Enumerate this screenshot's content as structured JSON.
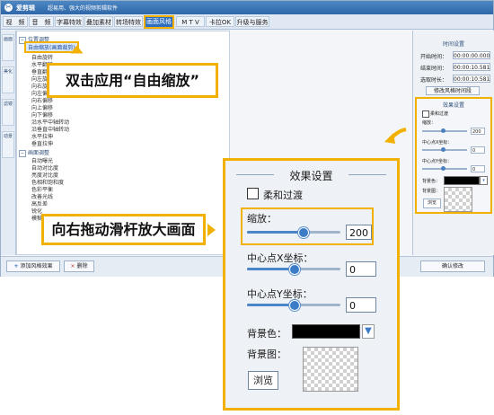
{
  "app": {
    "name": "爱剪辑",
    "slogan": "超易用、强大的视频剪辑软件",
    "menu": [
      "视　频",
      "音　频",
      "字幕特效",
      "叠加素材",
      "转场特效",
      "画面风格",
      "M T V",
      "卡拉OK",
      "升级与服务"
    ],
    "active_menu": "画面风格"
  },
  "left_strip": {
    "tabs": [
      "画面",
      "美化",
      "滤镜",
      "动景"
    ]
  },
  "effect_list": {
    "groups": [
      {
        "label": "位置调整",
        "items": [
          "自由缩放(画面裁剪)",
          "自由旋转",
          "水平翻转",
          "垂直翻转",
          "向左旋转",
          "向右旋转",
          "向左偏移",
          "向右偏移",
          "向上偏移",
          "向下偏移",
          "沿水平中轴转动",
          "沿垂直中轴转动",
          "水平拉伸",
          "垂直拉伸"
        ]
      },
      {
        "label": "画面调整",
        "items": [
          "自动曝光",
          "自动对比度",
          "亮度对比度",
          "色相和饱和度",
          "色彩平衡",
          "改善光线",
          "高反差",
          "锐化",
          "模糊"
        ]
      }
    ],
    "selected_item": "自由缩放(画面裁剪)"
  },
  "right_panel": {
    "time_title": "时间设置",
    "start_label": "开始时间：",
    "start_value": "00:00:00.000",
    "end_label": "结束时间：",
    "end_value": "00:00:10.581",
    "duration_label": "选取时长：",
    "duration_value": "00:00:10.581",
    "time_button": "修改风格时间段",
    "effects_title": "效果设置",
    "smooth_label": "柔和过渡",
    "zoom_label": "缩放：",
    "zoom_value": "200",
    "cx_label": "中心点X坐标：",
    "cx_value": "0",
    "cy_label": "中心点Y坐标：",
    "cy_value": "0",
    "bg_color_label": "背景色：",
    "bg_image_label": "背景图：",
    "browse_label": "浏览"
  },
  "bottom_bar": {
    "add_button": "添加风格效果",
    "delete_button": "删除",
    "confirm_button": "确认修改"
  },
  "callouts": {
    "double_click": "双击应用“自由缩放”",
    "drag_slider": "向右拖动滑杆放大画面"
  },
  "zoom_panel": {
    "title": "效果设置",
    "smooth_label": "柔和过渡",
    "zoom_label": "缩放：",
    "zoom_value": "200",
    "zoom_level": 0.6,
    "cx_label": "中心点X坐标：",
    "cx_value": "0",
    "cx_level": 0.5,
    "cy_label": "中心点Y坐标：",
    "cy_value": "0",
    "cy_level": 0.5,
    "bg_color_label": "背景色：",
    "bg_color_value": "#000000",
    "bg_image_label": "背景图：",
    "browse_label": "浏览"
  },
  "colors": {
    "accent": "#f2b100",
    "menu_active": "#2f6fc1",
    "slider": "#3c7cc6"
  }
}
